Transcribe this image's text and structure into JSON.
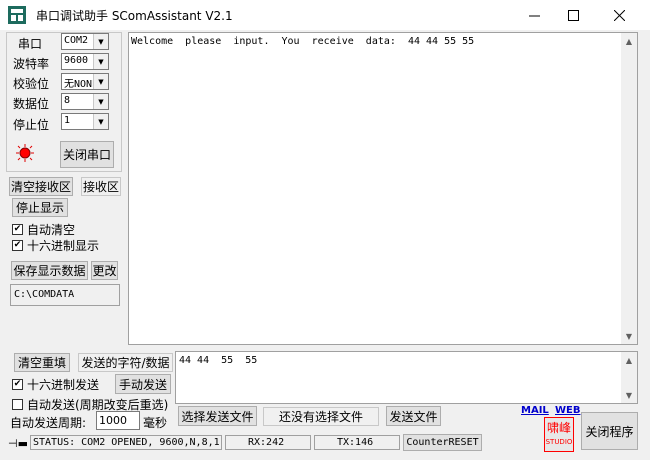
{
  "window": {
    "title": "串口调试助手 SComAssistant V2.1"
  },
  "settings": {
    "port_label": "串口",
    "port_value": "COM2",
    "baud_label": "波特率",
    "baud_value": "9600",
    "parity_label": "校验位",
    "parity_value": "无NONE",
    "databits_label": "数据位",
    "databits_value": "8",
    "stopbits_label": "停止位",
    "stopbits_value": "1",
    "close_port_label": "关闭串口"
  },
  "receive": {
    "clear_label": "清空接收区",
    "area_label": "接收区",
    "stop_display_label": "停止显示",
    "auto_clear_label": "自动清空",
    "hex_display_label": "十六进制显示",
    "save_label": "保存显示数据",
    "change_label": "更改",
    "path": "C:\\COMDATA",
    "content": "Welcome  please  input.  You  receive  data:  44 44 55 55"
  },
  "send": {
    "clear_label": "清空重填",
    "chars_label": "发送的字符/数据",
    "content": "44 44  55  55",
    "hex_send_label": "十六进制发送",
    "manual_send_label": "手动发送",
    "auto_send_label": "自动发送(周期改变后重选)",
    "period_label": "自动发送周期:",
    "period_value": "1000",
    "period_unit": "毫秒",
    "select_file_label": "选择发送文件",
    "no_file_label": "还没有选择文件",
    "send_file_label": "发送文件"
  },
  "links": {
    "mail": "MAIL",
    "web": "WEB"
  },
  "logo": {
    "line1": "啸峰",
    "line2": "STUDIO"
  },
  "close_program_label": "关闭程序",
  "status": {
    "text": "STATUS: COM2 OPENED, 9600,N,8,1",
    "rx": "RX:242",
    "tx": "TX:146",
    "reset_label": "CounterRESET"
  }
}
